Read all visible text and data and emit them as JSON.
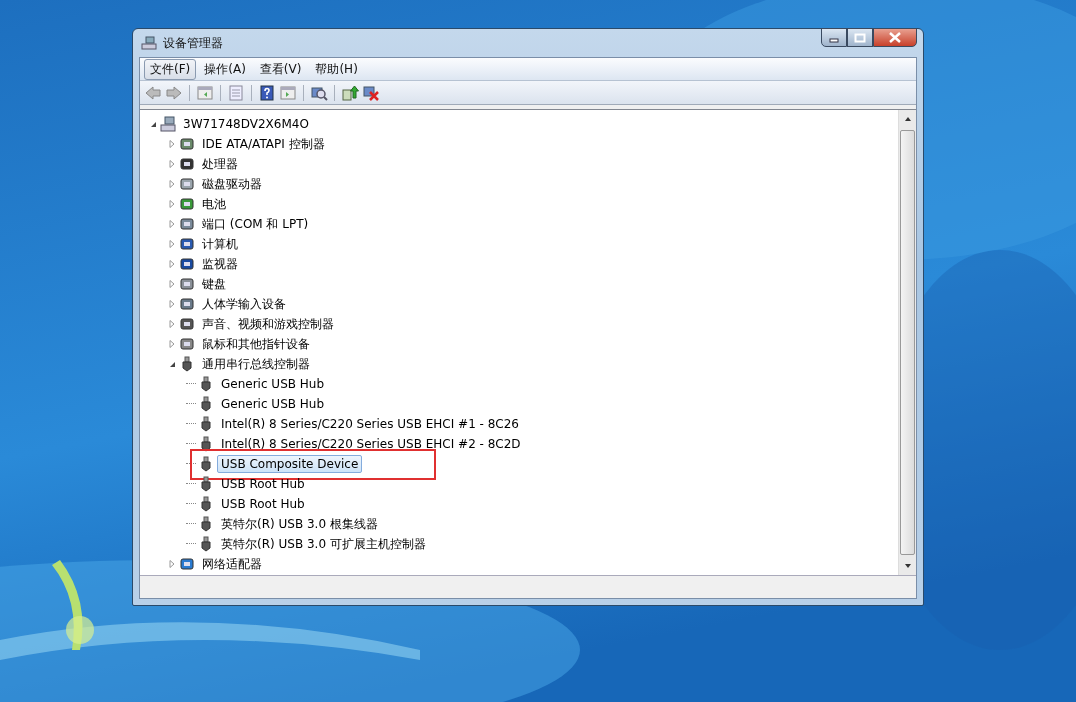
{
  "window": {
    "title": "设备管理器"
  },
  "menu": [
    {
      "label": "文件(F)",
      "selected": true
    },
    {
      "label": "操作(A)",
      "selected": false
    },
    {
      "label": "查看(V)",
      "selected": false
    },
    {
      "label": "帮助(H)",
      "selected": false
    }
  ],
  "tree": {
    "label": "3W71748DV2X6M4O",
    "expanded": true,
    "selected": false,
    "children": [
      {
        "label": "IDE ATA/ATAPI 控制器",
        "expanded": false,
        "selected": false
      },
      {
        "label": "处理器",
        "expanded": false,
        "selected": false
      },
      {
        "label": "磁盘驱动器",
        "expanded": false,
        "selected": false
      },
      {
        "label": "电池",
        "expanded": false,
        "selected": false
      },
      {
        "label": "端口 (COM 和 LPT)",
        "expanded": false,
        "selected": false
      },
      {
        "label": "计算机",
        "expanded": false,
        "selected": false
      },
      {
        "label": "监视器",
        "expanded": false,
        "selected": false
      },
      {
        "label": "键盘",
        "expanded": false,
        "selected": false
      },
      {
        "label": "人体学输入设备",
        "expanded": false,
        "selected": false
      },
      {
        "label": "声音、视频和游戏控制器",
        "expanded": false,
        "selected": false
      },
      {
        "label": "鼠标和其他指针设备",
        "expanded": false,
        "selected": false
      },
      {
        "label": "通用串行总线控制器",
        "expanded": true,
        "selected": false,
        "children": [
          {
            "label": "Generic USB Hub",
            "selected": false
          },
          {
            "label": "Generic USB Hub",
            "selected": false
          },
          {
            "label": "Intel(R) 8 Series/C220 Series USB EHCI #1 - 8C26",
            "selected": false
          },
          {
            "label": "Intel(R) 8 Series/C220 Series USB EHCI #2 - 8C2D",
            "selected": false
          },
          {
            "label": "USB Composite Device",
            "selected": true
          },
          {
            "label": "USB Root Hub",
            "selected": false
          },
          {
            "label": "USB Root Hub",
            "selected": false
          },
          {
            "label": "英特尔(R) USB 3.0 根集线器",
            "selected": false
          },
          {
            "label": "英特尔(R) USB 3.0 可扩展主机控制器",
            "selected": false
          }
        ]
      },
      {
        "label": "网络适配器",
        "expanded": false,
        "selected": false
      }
    ]
  }
}
